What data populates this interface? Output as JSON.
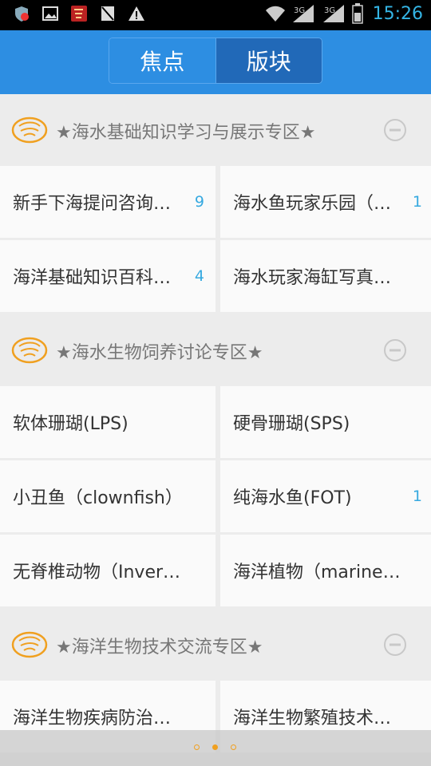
{
  "status_bar": {
    "time": "15:26",
    "icons": [
      "shield-icon",
      "image-icon",
      "app-icon",
      "no-sim-icon",
      "warning-icon",
      "wifi-icon",
      "signal-icon",
      "signal-icon",
      "battery-icon"
    ]
  },
  "tabs": [
    {
      "label": "焦点",
      "active": false
    },
    {
      "label": "版块",
      "active": true
    }
  ],
  "sections": [
    {
      "title": "★海水基础知识学习与展示专区★",
      "items": [
        {
          "name": "新手下海提问咨询专区",
          "count": "9"
        },
        {
          "name": "海水鱼玩家乐园（新手）",
          "count": "1"
        },
        {
          "name": "海洋基础知识百科全书",
          "count": "4"
        },
        {
          "name": "海水玩家海缸写真（展示）",
          "count": ""
        }
      ]
    },
    {
      "title": "★海水生物饲养讨论专区★",
      "items": [
        {
          "name": "软体珊瑚(LPS)",
          "count": ""
        },
        {
          "name": "硬骨珊瑚(SPS)",
          "count": ""
        },
        {
          "name": "小丑鱼（clownfish）",
          "count": ""
        },
        {
          "name": "纯海水鱼(FOT)",
          "count": "1"
        },
        {
          "name": "无脊椎动物（Invertebrates）",
          "count": ""
        },
        {
          "name": "海洋植物（marine plants）",
          "count": ""
        }
      ]
    },
    {
      "title": "★海洋生物技术交流专区★",
      "items": [
        {
          "name": "海洋生物疾病防治（医疗）",
          "count": ""
        },
        {
          "name": "海洋生物繁殖技术（交流）",
          "count": ""
        }
      ]
    }
  ],
  "pager": {
    "count": 3,
    "active_index": 1
  },
  "colors": {
    "accent": "#2d8ee2",
    "count": "#36a9e0",
    "status_time": "#34b5e5",
    "pager": "#f0a020"
  }
}
